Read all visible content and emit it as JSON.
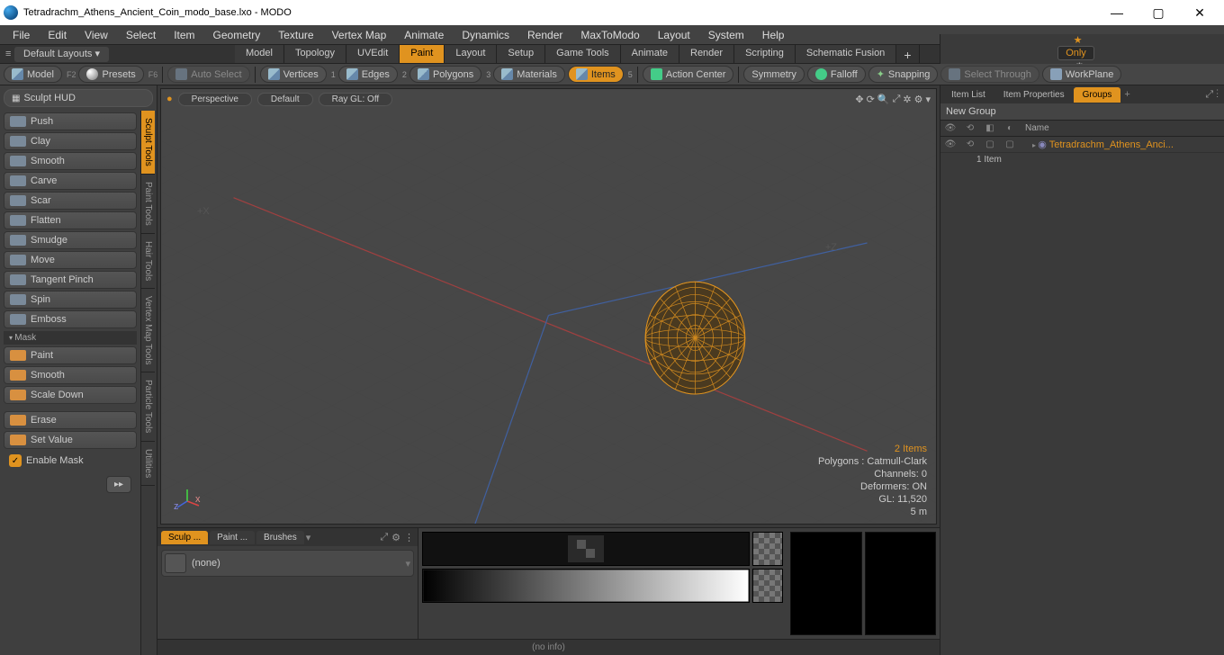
{
  "window": {
    "title": "Tetradrachm_Athens_Ancient_Coin_modo_base.lxo - MODO"
  },
  "menu": [
    "File",
    "Edit",
    "View",
    "Select",
    "Item",
    "Geometry",
    "Texture",
    "Vertex Map",
    "Animate",
    "Dynamics",
    "Render",
    "MaxToModo",
    "Layout",
    "System",
    "Help"
  ],
  "layoutbar": {
    "label": "Default Layouts ▾",
    "tabs": [
      "Model",
      "Topology",
      "UVEdit",
      "Paint",
      "Layout",
      "Setup",
      "Game Tools",
      "Animate",
      "Render",
      "Scripting",
      "Schematic Fusion"
    ],
    "active": "Paint",
    "only": "Only"
  },
  "toolbar": {
    "model": "Model",
    "model_key": "F2",
    "presets": "Presets",
    "presets_key": "F6",
    "autosel": "Auto Select",
    "vertices": "Vertices",
    "vertices_n": "1",
    "edges": "Edges",
    "edges_n": "2",
    "polygons": "Polygons",
    "polygons_n": "3",
    "materials": "Materials",
    "items": "Items",
    "items_n": "5",
    "action": "Action Center",
    "symmetry": "Symmetry",
    "falloff": "Falloff",
    "snapping": "Snapping",
    "selthrough": "Select Through",
    "workplane": "WorkPlane"
  },
  "left": {
    "hud": "Sculpt HUD",
    "tools": [
      "Push",
      "Clay",
      "Smooth",
      "Carve",
      "Scar",
      "Flatten",
      "Smudge",
      "Move",
      "Tangent Pinch",
      "Spin",
      "Emboss"
    ],
    "mask_hdr": "Mask",
    "mask_tools": [
      "Paint",
      "Smooth",
      "Scale Down"
    ],
    "erase_tools": [
      "Erase",
      "Set Value"
    ],
    "enable": "Enable Mask",
    "vtabs": [
      "Sculpt Tools",
      "Paint Tools",
      "Hair Tools",
      "Vertex Map Tools",
      "Particle Tools",
      "Utilities"
    ]
  },
  "viewport": {
    "view": "Perspective",
    "shade": "Default",
    "ray": "Ray GL: Off",
    "ax_x": "+X",
    "ax_z": "+Z",
    "stats": {
      "items": "2 Items",
      "poly": "Polygons : Catmull-Clark",
      "chan": "Channels: 0",
      "def": "Deformers: ON",
      "gl": "GL: 11,520",
      "scale": "5 m"
    }
  },
  "bottom": {
    "tabs": [
      "Sculp ...",
      "Paint ...",
      "Brushes"
    ],
    "none": "(none)",
    "status": "(no info)"
  },
  "rightp": {
    "tabs": [
      "Item List",
      "Item Properties",
      "Groups"
    ],
    "active": "Groups",
    "group": "New Group",
    "name_col": "Name",
    "item": "Tetradrachm_Athens_Anci...",
    "count": "1 Item"
  }
}
